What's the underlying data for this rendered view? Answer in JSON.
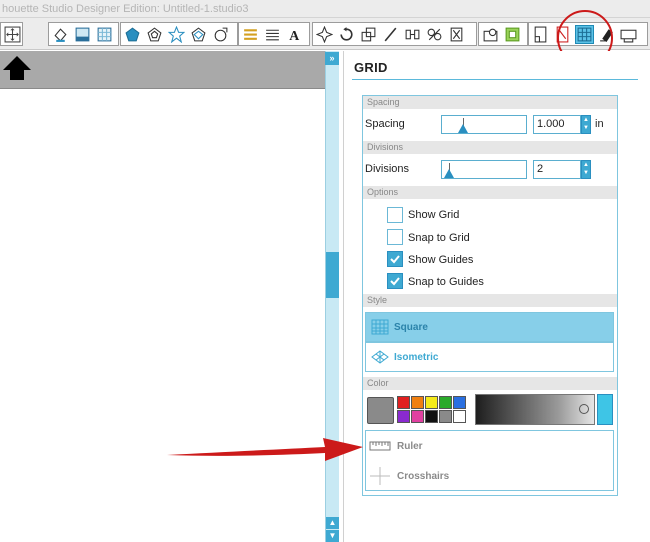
{
  "window": {
    "title": "houette Studio Designer Edition: Untitled-1.studio3"
  },
  "toolbar": {
    "groups": [
      {
        "name": "page",
        "buttons": [
          "move-icon"
        ]
      },
      {
        "name": "fill",
        "buttons": [
          "fill-bucket-icon",
          "line-style-icon",
          "pattern-icon"
        ]
      },
      {
        "name": "shapes",
        "buttons": [
          "pentagon-icon",
          "hexagon-icon",
          "star-icon",
          "shape-outline-icon",
          "rotate-shape-icon"
        ]
      },
      {
        "name": "text",
        "buttons": [
          "align-icon",
          "lines-icon",
          "text-icon"
        ]
      },
      {
        "name": "transform",
        "buttons": [
          "replicate-icon",
          "rotate-icon",
          "scale-icon",
          "line-icon",
          "offset-icon",
          "trace-icon",
          "knife-icon"
        ]
      },
      {
        "name": "misc",
        "buttons": [
          "modify-icon",
          "group-icon"
        ]
      },
      {
        "name": "panels",
        "buttons": [
          "page-setup-icon",
          "cut-settings-icon",
          "grid-icon",
          "eraser-icon",
          "send-icon"
        ]
      }
    ]
  },
  "panel": {
    "title": "GRID",
    "spacing": {
      "header": "Spacing",
      "label": "Spacing",
      "value": "1.000",
      "unit": "in"
    },
    "divisions": {
      "header": "Divisions",
      "label": "Divisions",
      "value": "2"
    },
    "options": {
      "header": "Options",
      "items": [
        {
          "label": "Show Grid",
          "checked": false
        },
        {
          "label": "Snap to Grid",
          "checked": false
        },
        {
          "label": "Show Guides",
          "checked": true
        },
        {
          "label": "Snap to Guides",
          "checked": true
        }
      ]
    },
    "style": {
      "header": "Style",
      "items": [
        {
          "label": "Square",
          "selected": true
        },
        {
          "label": "Isometric",
          "selected": false
        }
      ]
    },
    "color": {
      "header": "Color",
      "current": "#8a8a8a",
      "swatches": [
        "#e02020",
        "#f07f10",
        "#f5ea1a",
        "#2aaa2a",
        "#2a6fe0",
        "#8a2ad0",
        "#e040a0",
        "#111111",
        "#8a8a8a",
        "#ffffff"
      ]
    },
    "tools": [
      {
        "label": "Ruler"
      },
      {
        "label": "Crosshairs"
      }
    ]
  },
  "accent": "#3ea9d2",
  "annotation_color": "#cc1a1a"
}
